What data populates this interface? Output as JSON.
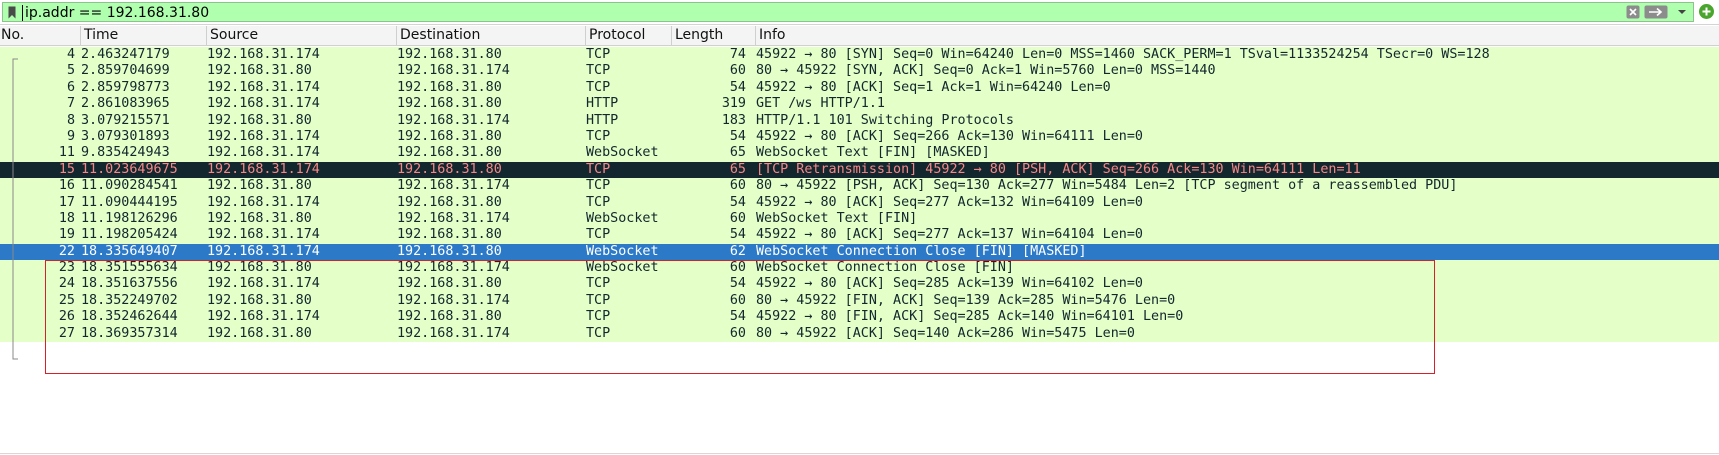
{
  "filter": {
    "value": "ip.addr == 192.168.31.80",
    "background": "#afffaf"
  },
  "icons": {
    "bookmark": "bookmark-icon",
    "clear": "clear-icon",
    "apply": "apply-arrow-icon",
    "dropdown": "chevron-down-icon",
    "add": "add-plus-icon"
  },
  "columns": {
    "no": "No.",
    "time": "Time",
    "source": "Source",
    "destination": "Destination",
    "protocol": "Protocol",
    "length": "Length",
    "info": "Info"
  },
  "colors": {
    "row_bg": "#e4ffc7",
    "dark_row_bg": "#12272e",
    "dark_row_fg": "#f78787",
    "selected_bg": "#2b79c7",
    "highlight_border": "#d6212c"
  },
  "packets": [
    {
      "no": "4",
      "time": "2.463247179",
      "source": "192.168.31.174",
      "destination": "192.168.31.80",
      "protocol": "TCP",
      "length": "74",
      "info": "45922 → 80 [SYN] Seq=0 Win=64240 Len=0 MSS=1460 SACK_PERM=1 TSval=1133524254 TSecr=0 WS=128",
      "style": "normal"
    },
    {
      "no": "5",
      "time": "2.859704699",
      "source": "192.168.31.80",
      "destination": "192.168.31.174",
      "protocol": "TCP",
      "length": "60",
      "info": "80 → 45922 [SYN, ACK] Seq=0 Ack=1 Win=5760 Len=0 MSS=1440",
      "style": "normal"
    },
    {
      "no": "6",
      "time": "2.859798773",
      "source": "192.168.31.174",
      "destination": "192.168.31.80",
      "protocol": "TCP",
      "length": "54",
      "info": "45922 → 80 [ACK] Seq=1 Ack=1 Win=64240 Len=0",
      "style": "normal"
    },
    {
      "no": "7",
      "time": "2.861083965",
      "source": "192.168.31.174",
      "destination": "192.168.31.80",
      "protocol": "HTTP",
      "length": "319",
      "info": "GET /ws HTTP/1.1",
      "style": "normal"
    },
    {
      "no": "8",
      "time": "3.079215571",
      "source": "192.168.31.80",
      "destination": "192.168.31.174",
      "protocol": "HTTP",
      "length": "183",
      "info": "HTTP/1.1 101 Switching Protocols",
      "style": "normal"
    },
    {
      "no": "9",
      "time": "3.079301893",
      "source": "192.168.31.174",
      "destination": "192.168.31.80",
      "protocol": "TCP",
      "length": "54",
      "info": "45922 → 80 [ACK] Seq=266 Ack=130 Win=64111 Len=0",
      "style": "normal"
    },
    {
      "no": "11",
      "time": "9.835424943",
      "source": "192.168.31.174",
      "destination": "192.168.31.80",
      "protocol": "WebSocket",
      "length": "65",
      "info": "WebSocket Text [FIN] [MASKED]",
      "style": "normal"
    },
    {
      "no": "15",
      "time": "11.023649675",
      "source": "192.168.31.174",
      "destination": "192.168.31.80",
      "protocol": "TCP",
      "length": "65",
      "info": "[TCP Retransmission] 45922 → 80 [PSH, ACK] Seq=266 Ack=130 Win=64111 Len=11",
      "style": "dark"
    },
    {
      "no": "16",
      "time": "11.090284541",
      "source": "192.168.31.80",
      "destination": "192.168.31.174",
      "protocol": "TCP",
      "length": "60",
      "info": "80 → 45922 [PSH, ACK] Seq=130 Ack=277 Win=5484 Len=2 [TCP segment of a reassembled PDU]",
      "style": "normal"
    },
    {
      "no": "17",
      "time": "11.090444195",
      "source": "192.168.31.174",
      "destination": "192.168.31.80",
      "protocol": "TCP",
      "length": "54",
      "info": "45922 → 80 [ACK] Seq=277 Ack=132 Win=64109 Len=0",
      "style": "normal"
    },
    {
      "no": "18",
      "time": "11.198126296",
      "source": "192.168.31.80",
      "destination": "192.168.31.174",
      "protocol": "WebSocket",
      "length": "60",
      "info": "WebSocket Text [FIN]",
      "style": "normal"
    },
    {
      "no": "19",
      "time": "11.198205424",
      "source": "192.168.31.174",
      "destination": "192.168.31.80",
      "protocol": "TCP",
      "length": "54",
      "info": "45922 → 80 [ACK] Seq=277 Ack=137 Win=64104 Len=0",
      "style": "normal"
    },
    {
      "no": "22",
      "time": "18.335649407",
      "source": "192.168.31.174",
      "destination": "192.168.31.80",
      "protocol": "WebSocket",
      "length": "62",
      "info": "WebSocket Connection Close [FIN] [MASKED]",
      "style": "selected"
    },
    {
      "no": "23",
      "time": "18.351555634",
      "source": "192.168.31.80",
      "destination": "192.168.31.174",
      "protocol": "WebSocket",
      "length": "60",
      "info": "WebSocket Connection Close [FIN]",
      "style": "normal"
    },
    {
      "no": "24",
      "time": "18.351637556",
      "source": "192.168.31.174",
      "destination": "192.168.31.80",
      "protocol": "TCP",
      "length": "54",
      "info": "45922 → 80 [ACK] Seq=285 Ack=139 Win=64102 Len=0",
      "style": "normal"
    },
    {
      "no": "25",
      "time": "18.352249702",
      "source": "192.168.31.80",
      "destination": "192.168.31.174",
      "protocol": "TCP",
      "length": "60",
      "info": "80 → 45922 [FIN, ACK] Seq=139 Ack=285 Win=5476 Len=0",
      "style": "normal"
    },
    {
      "no": "26",
      "time": "18.352462644",
      "source": "192.168.31.174",
      "destination": "192.168.31.80",
      "protocol": "TCP",
      "length": "54",
      "info": "45922 → 80 [FIN, ACK] Seq=285 Ack=140 Win=64101 Len=0",
      "style": "normal"
    },
    {
      "no": "27",
      "time": "18.369357314",
      "source": "192.168.31.80",
      "destination": "192.168.31.174",
      "protocol": "TCP",
      "length": "60",
      "info": "80 → 45922 [ACK] Seq=140 Ack=286 Win=5475 Len=0",
      "style": "normal"
    }
  ]
}
